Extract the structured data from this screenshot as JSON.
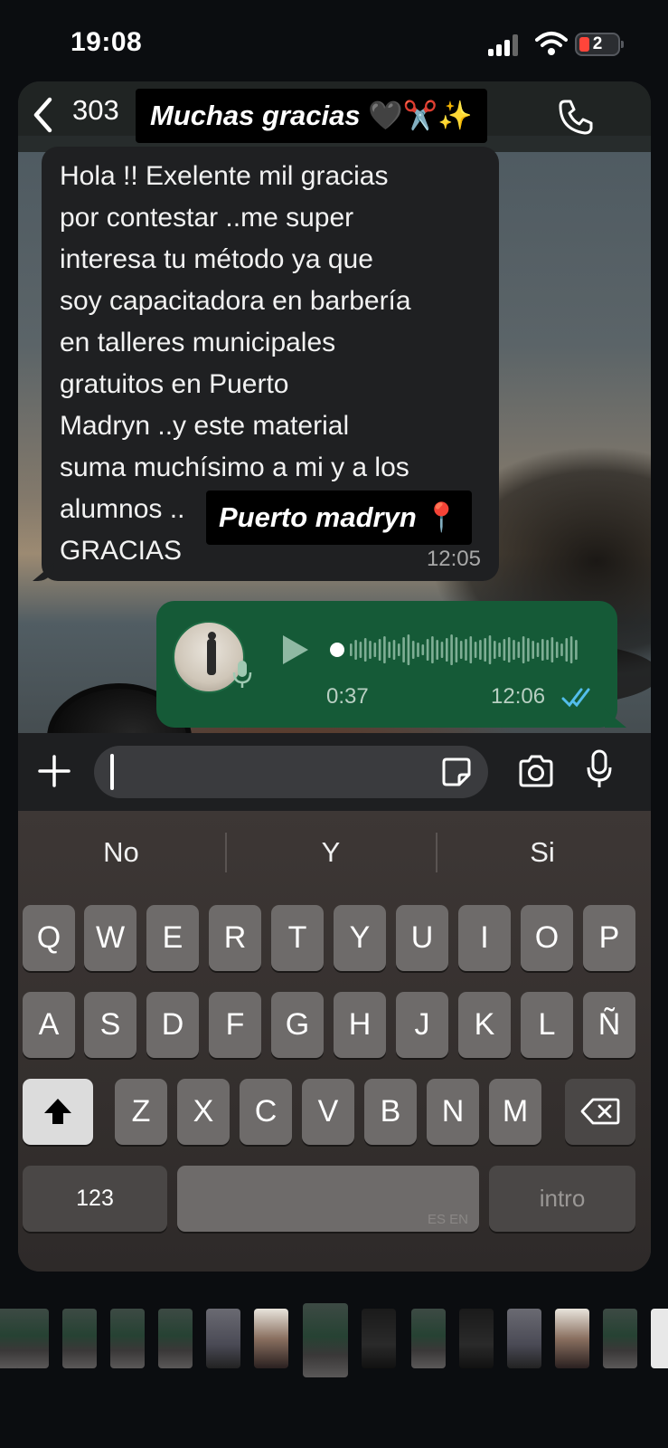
{
  "status_bar": {
    "time": "19:08",
    "battery": "2"
  },
  "header": {
    "contact_prefix": "303",
    "sticker_text": "Muchas gracias",
    "sticker_emoji": "🖤✂️✨"
  },
  "incoming_message": {
    "text": "Hola !! Exelente mil gracias\npor contestar ..me super\ninteresa tu método ya que\nsoy capacitadora en barbería\nen talleres municipales\ngratuitos en Puerto\nMadryn ..y este material\nsuma muchísimo a mi y a los\nalumnos ..\nGRACIAS",
    "time": "12:05"
  },
  "location_sticker": {
    "text": "Puerto madryn",
    "emoji": "📍"
  },
  "voice_message": {
    "duration": "0:37",
    "time": "12:06",
    "status": "read"
  },
  "input": {
    "placeholder": ""
  },
  "suggestions": [
    "No",
    "Y",
    "Si"
  ],
  "keyboard": {
    "row1": [
      "Q",
      "W",
      "E",
      "R",
      "T",
      "Y",
      "U",
      "I",
      "O",
      "P"
    ],
    "row2": [
      "A",
      "S",
      "D",
      "F",
      "G",
      "H",
      "J",
      "K",
      "L",
      "Ñ"
    ],
    "row3": [
      "Z",
      "X",
      "C",
      "V",
      "B",
      "N",
      "M"
    ],
    "numbers_label": "123",
    "space_languages": "ES EN",
    "return_label": "intro"
  },
  "icons": {
    "back": "chevron-left-icon",
    "call": "phone-icon",
    "plus": "plus-icon",
    "sticker": "sticker-icon",
    "camera": "camera-icon",
    "mic": "microphone-icon",
    "play": "play-icon",
    "shift": "shift-icon",
    "delete": "backspace-icon"
  },
  "colors": {
    "outgoing_bubble": "#155a37",
    "incoming_bubble": "#1f2022",
    "read_ticks": "#53bdeb"
  }
}
